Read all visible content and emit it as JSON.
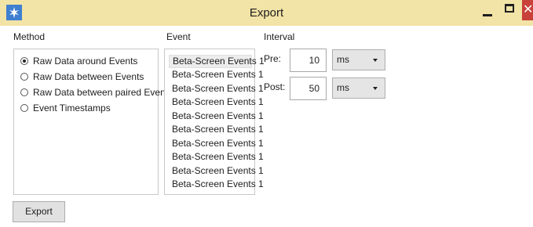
{
  "window": {
    "title": "Export",
    "min_label": "",
    "max_label": "",
    "close_label": "✕"
  },
  "method": {
    "heading": "Method",
    "options": [
      {
        "label": "Raw Data around Events",
        "selected": true
      },
      {
        "label": "Raw Data between Events",
        "selected": false
      },
      {
        "label": "Raw Data between paired Events",
        "selected": false
      },
      {
        "label": "Event Timestamps",
        "selected": false
      }
    ]
  },
  "event": {
    "heading": "Event",
    "items": [
      "Beta-Screen Events 1",
      "Beta-Screen Events 1",
      "Beta-Screen Events 1",
      "Beta-Screen Events 1",
      "Beta-Screen Events 1",
      "Beta-Screen Events 1",
      "Beta-Screen Events 1",
      "Beta-Screen Events 1",
      "Beta-Screen Events 1",
      "Beta-Screen Events 1"
    ]
  },
  "interval": {
    "heading": "Interval",
    "pre": {
      "label": "Pre:",
      "value": "10",
      "unit": "ms"
    },
    "post": {
      "label": "Post:",
      "value": "50",
      "unit": "ms"
    }
  },
  "actions": {
    "export_label": "Export"
  },
  "colors": {
    "titlebar": "#f2e3a6",
    "close": "#c8413a",
    "app_icon": "#3f7fd0"
  },
  "icons": {
    "app": "gear-star-icon",
    "minimize": "minimize-icon",
    "maximize": "maximize-icon",
    "close": "close-icon"
  }
}
